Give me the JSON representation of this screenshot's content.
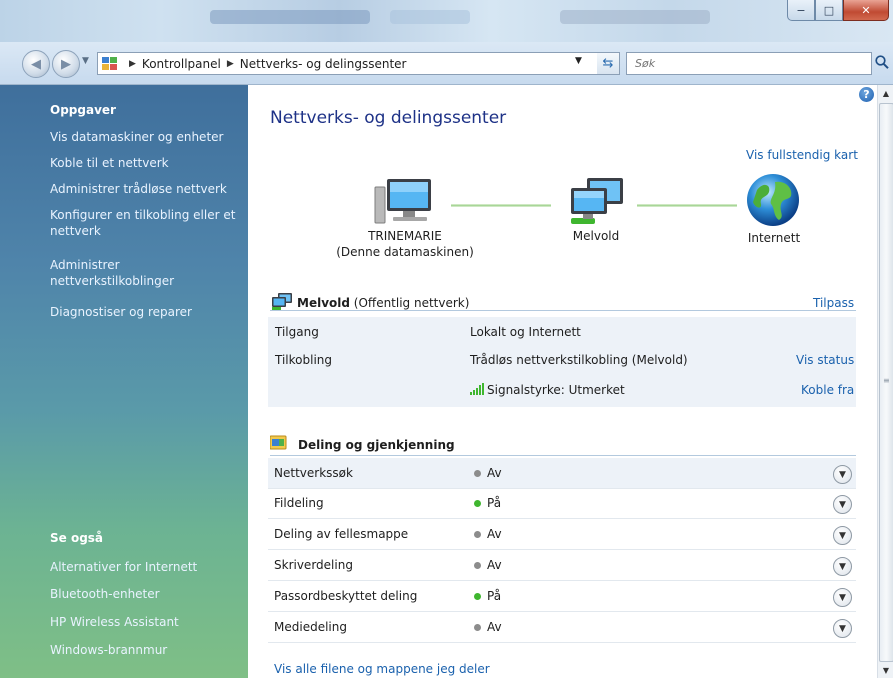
{
  "window": {
    "captions": {
      "minimize": "−",
      "maximize": "□",
      "close": "✕"
    }
  },
  "nav": {
    "back_icon": "arrow-left-icon",
    "forward_icon": "arrow-right-icon",
    "breadcrumbs": [
      "Kontrollpanel",
      "Nettverks- og delingssenter"
    ],
    "search_placeholder": "Søk"
  },
  "sidebar": {
    "tasks_heading": "Oppgaver",
    "tasks": [
      "Vis datamaskiner og enheter",
      "Koble til et nettverk",
      "Administrer trådløse nettverk",
      "Konfigurer en tilkobling eller et nettverk",
      "Administrer nettverkstilkoblinger",
      "Diagnostiser og reparer"
    ],
    "see_also_heading": "Se også",
    "see_also": [
      "Alternativer for Internett",
      "Bluetooth-enheter",
      "HP Wireless Assistant",
      "Windows-brannmur"
    ]
  },
  "main": {
    "title": "Nettverks- og delingssenter",
    "full_map_link": "Vis fullstendig kart",
    "help_label": "?",
    "map": {
      "computer_name": "TRINEMARIE",
      "computer_sub": "(Denne datamaskinen)",
      "network_name": "Melvold",
      "internet_name": "Internett"
    },
    "network": {
      "name": "Melvold",
      "type": "(Offentlig nettverk)",
      "customize_link": "Tilpass",
      "rows": [
        {
          "label": "Tilgang",
          "value": "Lokalt og Internett",
          "action": ""
        },
        {
          "label": "Tilkobling",
          "value": "Trådløs nettverkstilkobling (Melvold)",
          "action": "Vis status"
        },
        {
          "label": "",
          "value": "Signalstyrke: Utmerket",
          "action": "Koble fra"
        }
      ]
    },
    "sharing": {
      "heading": "Deling og gjenkjenning",
      "rows": [
        {
          "label": "Nettverkssøk",
          "state": "Av"
        },
        {
          "label": "Fildeling",
          "state": "På"
        },
        {
          "label": "Deling av fellesmappe",
          "state": "Av"
        },
        {
          "label": "Skriverdeling",
          "state": "Av"
        },
        {
          "label": "Passordbeskyttet deling",
          "state": "På"
        },
        {
          "label": "Mediedeling",
          "state": "Av"
        }
      ]
    },
    "show_shared_link": "Vis alle filene og mappene jeg deler"
  },
  "colors": {
    "on": "#3fb62f",
    "off": "#8c8c8c",
    "link": "#1a61ad",
    "title": "#1e3287"
  }
}
